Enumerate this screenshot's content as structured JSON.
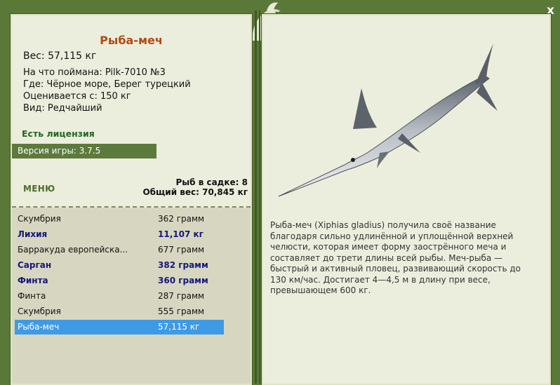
{
  "window": {
    "close_label": "x"
  },
  "fish": {
    "title": "Рыба-меч",
    "weight": "Вес: 57,115 кг",
    "caught_on": "На что поймана: Pilk-7010 №3",
    "location": "Где: Чёрное море, Берег турецкий",
    "rated_from": "Оценивается с: 150 кг",
    "kind": "Вид: Редчайший"
  },
  "license": "Есть лицензия",
  "version": "Версия игры: 3.7.5",
  "menu_label": "МЕНЮ",
  "keep": {
    "count": "Рыб в садке: 8",
    "total": "Общий вес: 70,845 кг"
  },
  "catch_list": [
    {
      "name": "Скумбрия",
      "weight": "362 грамм",
      "bold": false,
      "selected": false
    },
    {
      "name": "Лихия",
      "weight": "11,107 кг",
      "bold": true,
      "selected": false
    },
    {
      "name": "Барракуда европейска...",
      "weight": "677 грамм",
      "bold": false,
      "selected": false
    },
    {
      "name": "Сарган",
      "weight": "382 грамм",
      "bold": true,
      "selected": false
    },
    {
      "name": "Финта",
      "weight": "360 грамм",
      "bold": true,
      "selected": false
    },
    {
      "name": "Финта",
      "weight": "287 грамм",
      "bold": false,
      "selected": false
    },
    {
      "name": "Скумбрия",
      "weight": "555 грамм",
      "bold": false,
      "selected": false
    },
    {
      "name": "Рыба-меч",
      "weight": "57,115 кг",
      "bold": false,
      "selected": true
    }
  ],
  "description": "Рыба-меч (Xiphias gladius) получила своё название благодаря сильно удлинённой и уплощённой верхней челюсти, которая имеет форму заострённого меча и составляет до трети длины всей рыбы. Меч-рыба — быстрый и активный пловец, развивающий скорость до 130 км/час. Достигает 4—4,5 м в длину при весе, превышающем 600 кг.",
  "colors": {
    "frame": "#5a7838",
    "panel": "#eceedd",
    "accent_title": "#b34a12",
    "selected": "#3f9ae6",
    "bold_row": "#16167a"
  },
  "icons": {
    "emblem": "fish-emblem-icon",
    "close": "close-icon",
    "fish": "swordfish-illustration"
  }
}
